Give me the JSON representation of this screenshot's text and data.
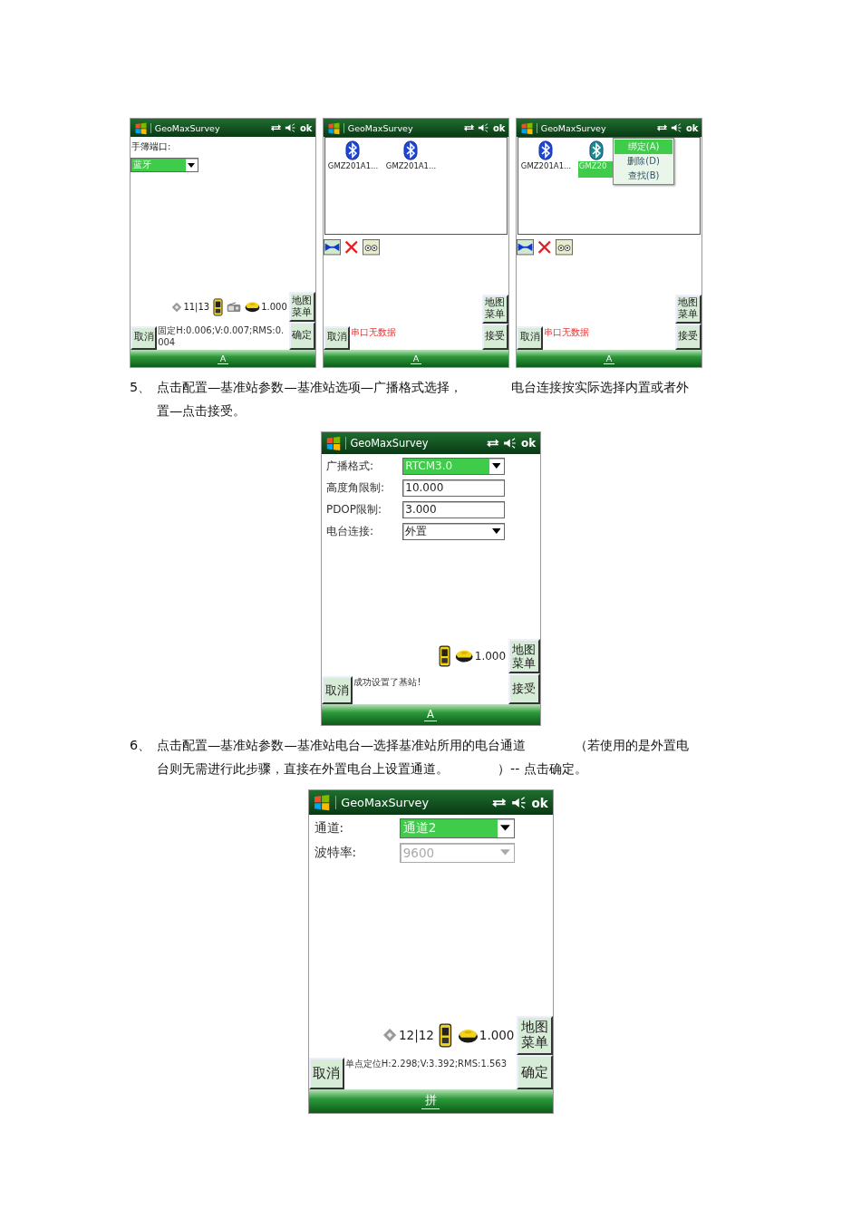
{
  "blocks": [
    {
      "kind": "screen_row",
      "screens": [
        {
          "title": "GeoMaxSurvey",
          "ok_label": "ok",
          "fields": [
            {
              "kind": "caption",
              "text": "手簿端口:"
            },
            {
              "kind": "dropdown",
              "value": "蓝牙",
              "highlighted": true,
              "disabled": false
            }
          ],
          "status": [
            {
              "kind": "satellites",
              "reading": "11|13"
            },
            {
              "kind": "controller"
            },
            {
              "kind": "radio"
            },
            {
              "kind": "rover",
              "reading": "1.000"
            }
          ],
          "message": {
            "kind": "info",
            "text": "固定H:0.006;V:0.007;RMS:0.004"
          },
          "cancel": "取消",
          "map_menu": "地图菜单",
          "confirm": "确定",
          "softkey": "A"
        },
        {
          "title": "GeoMaxSurvey",
          "ok_label": "ok",
          "devices": [
            {
              "name": "GMZ201A1...",
              "selected": false
            },
            {
              "name": "GMZ201A1...",
              "selected": false
            }
          ],
          "toolbar": [
            {
              "kind": "connect"
            },
            {
              "kind": "delete"
            },
            {
              "kind": "search"
            }
          ],
          "message": {
            "kind": "error",
            "text": "串口无数据"
          },
          "cancel": "取消",
          "map_menu": "地图菜单",
          "confirm": "接受",
          "softkey": "A"
        },
        {
          "title": "GeoMaxSurvey",
          "ok_label": "ok",
          "devices": [
            {
              "name": "GMZ201A1...",
              "selected": false
            },
            {
              "name": "GMZ20",
              "selected": true
            }
          ],
          "menu": [
            {
              "label": "绑定(A)",
              "selected": true
            },
            {
              "label": "删除(D)",
              "selected": false
            },
            {
              "label": "查找(B)",
              "selected": false
            }
          ],
          "toolbar": [
            {
              "kind": "connect"
            },
            {
              "kind": "delete"
            },
            {
              "kind": "search"
            }
          ],
          "message": {
            "kind": "error",
            "text": "串口无数据"
          },
          "cancel": "取消",
          "map_menu": "地图菜单",
          "confirm": "接受",
          "softkey": "A"
        }
      ]
    },
    {
      "kind": "step",
      "number": "5、",
      "lines": [
        [
          "点击配置—基准站参数—基准站选项—广播格式选择，",
          "电台连接按实际选择内置或者外"
        ],
        [
          "置—点击接受。"
        ]
      ]
    },
    {
      "kind": "screen",
      "screen": {
        "title": "GeoMaxSurvey",
        "ok_label": "ok",
        "fields": [
          {
            "kind": "dropdown",
            "label": "广播格式:",
            "value": "RTCM3.0",
            "highlighted": true,
            "disabled": false
          },
          {
            "kind": "input",
            "label": "高度角限制:",
            "value": "10.000"
          },
          {
            "kind": "input",
            "label": "PDOP限制:",
            "value": "3.000"
          },
          {
            "kind": "dropdown",
            "label": "电台连接:",
            "value": "外置",
            "highlighted": false,
            "disabled": false
          }
        ],
        "status": [
          {
            "kind": "controller"
          },
          {
            "kind": "rover",
            "reading": "1.000"
          }
        ],
        "message": {
          "kind": "info",
          "text": "成功设置了基站!"
        },
        "cancel": "取消",
        "map_menu": "地图菜单",
        "confirm": "接受",
        "softkey": "A"
      }
    },
    {
      "kind": "step",
      "number": "6、",
      "lines": [
        [
          "点击配置—基准站参数—基准站电台—选择基准站所用的电台通道",
          "（若使用的是外置电"
        ],
        [
          "台则无需进行此步骤，直接在外置电台上设置通道。",
          "）-- 点击确定。"
        ]
      ]
    },
    {
      "kind": "screen",
      "screen": {
        "title": "GeoMaxSurvey",
        "ok_label": "ok",
        "fields": [
          {
            "kind": "dropdown",
            "label": "通道:",
            "value": "通道2",
            "highlighted": true,
            "disabled": false
          },
          {
            "kind": "dropdown",
            "label": "波特率:",
            "value": "9600",
            "highlighted": false,
            "disabled": true
          }
        ],
        "status": [
          {
            "kind": "satellites",
            "reading": "12|12"
          },
          {
            "kind": "controller"
          },
          {
            "kind": "rover",
            "reading": "1.000"
          }
        ],
        "message": {
          "kind": "info",
          "text": "单点定位H:2.298;V:3.392;RMS:1.563"
        },
        "cancel": "取消",
        "map_menu": "地图菜单",
        "confirm": "确定",
        "softkey": "拼"
      }
    }
  ]
}
